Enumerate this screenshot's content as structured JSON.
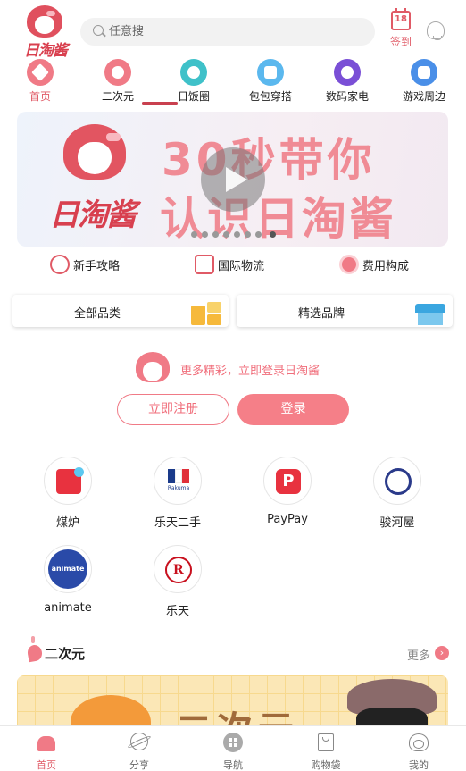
{
  "header": {
    "logo_text": "日淘酱",
    "search_placeholder": "任意搜",
    "signin_day": "18",
    "signin_label": "签到"
  },
  "categories": [
    {
      "label": "首页",
      "color": "#f07a86"
    },
    {
      "label": "二次元",
      "color": "#f07a86"
    },
    {
      "label": "日饭圈",
      "color": "#3fc1c9"
    },
    {
      "label": "包包穿搭",
      "color": "#5bb8ee"
    },
    {
      "label": "数码家电",
      "color": "#7a4fd6"
    },
    {
      "label": "游戏周边",
      "color": "#4a8fe8"
    }
  ],
  "banner": {
    "brand": "日淘酱",
    "line1": "30秒带你",
    "line2": "认识日淘酱"
  },
  "quick_links": [
    {
      "label": "新手攻略"
    },
    {
      "label": "国际物流"
    },
    {
      "label": "费用构成"
    }
  ],
  "cards": {
    "all_categories": "全部品类",
    "featured_brands": "精选品牌"
  },
  "login_prompt": {
    "text": "更多精彩，立即登录日淘酱",
    "register_label": "立即注册",
    "login_label": "登录"
  },
  "platforms": [
    {
      "label": "煤炉"
    },
    {
      "label": "乐天二手"
    },
    {
      "label": "PayPay"
    },
    {
      "label": "骏河屋"
    },
    {
      "label": "animate"
    },
    {
      "label": "乐天"
    }
  ],
  "platform_marks": {
    "rakuma": "Rakuma",
    "animate": "animate",
    "rakuten": "R",
    "paypay": "P"
  },
  "section": {
    "title": "二次元",
    "more_label": "更多",
    "banner_text": "二次元"
  },
  "tabbar": [
    {
      "label": "首页"
    },
    {
      "label": "分享"
    },
    {
      "label": "导航"
    },
    {
      "label": "购物袋"
    },
    {
      "label": "我的"
    }
  ],
  "colors": {
    "accent": "#f07a86",
    "accent_dark": "#e05a66"
  }
}
